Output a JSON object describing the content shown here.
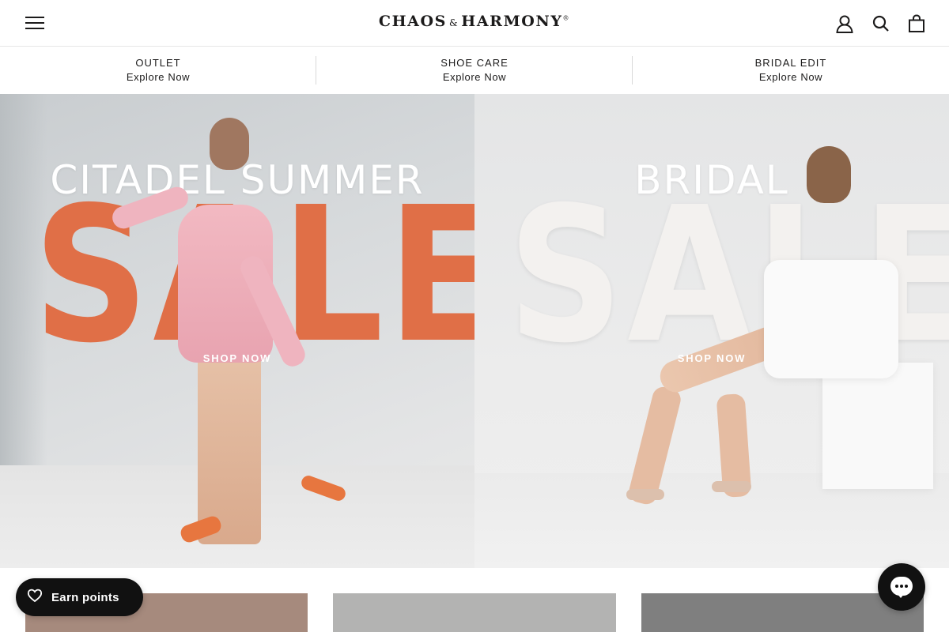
{
  "header": {
    "brand_main_1": "Chaos",
    "brand_amp": "&",
    "brand_main_2": "Harmony",
    "brand_reg": "®",
    "icons": [
      "menu-icon",
      "account-icon",
      "search-icon",
      "bag-icon"
    ]
  },
  "promo": {
    "items": [
      {
        "title": "OUTLET",
        "sub": "Explore Now"
      },
      {
        "title": "SHOE CARE",
        "sub": "Explore Now"
      },
      {
        "title": "BRIDAL EDIT",
        "sub": "Explore Now"
      }
    ]
  },
  "hero": {
    "left": {
      "overline": "CITADEL SUMMER",
      "headline": "SALE",
      "cta": "SHOP NOW",
      "accent": "#e06f47"
    },
    "right": {
      "overline": "BRIDAL",
      "headline": "SALE",
      "cta": "SHOP NOW",
      "accent": "#f3f1ef"
    }
  },
  "widgets": {
    "earn_label": "Earn points",
    "earn_icon": "heart-icon",
    "chat_icon": "chat-icon"
  },
  "colors": {
    "text": "#1c1b1b",
    "widget_bg": "#111111"
  }
}
